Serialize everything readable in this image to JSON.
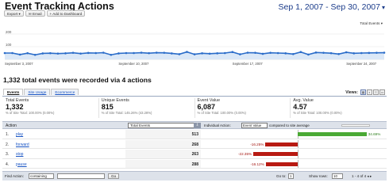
{
  "header": {
    "title": "Event Tracking Actions",
    "date_range": "Sep 1, 2007 - Sep 30, 2007"
  },
  "toolbar": {
    "export_label": "Export ▾",
    "email_label": "Email",
    "dashboard_label": "Add to Dashboard"
  },
  "chart": {
    "series_selector": "Total Events ▾",
    "y_ticks": [
      "200",
      "100"
    ],
    "x_ticks": [
      "September 3, 2007",
      "September 10, 2007",
      "September 17, 2007",
      "September 24, 2007"
    ],
    "line_color": "#2a6cc9",
    "fill_color": "#dbe8f7"
  },
  "chart_data": {
    "type": "area",
    "title": "",
    "series": [
      {
        "name": "Total Events",
        "values": [
          50,
          50,
          38,
          49,
          36,
          47,
          49,
          46,
          48,
          52,
          46,
          51,
          50,
          53,
          36,
          47,
          50,
          50,
          53,
          49,
          53,
          52,
          47,
          41,
          59,
          40,
          48,
          45,
          48,
          50,
          58,
          40,
          53,
          52,
          44,
          52,
          50,
          48,
          42,
          58,
          38,
          54,
          52,
          49,
          42,
          56,
          48,
          50,
          51,
          52,
          53
        ]
      }
    ],
    "ylim": [
      0,
      250
    ],
    "xlabel": "",
    "ylabel": "",
    "grid": true
  },
  "summary": {
    "text": "1,332 total events were recorded via 4 actions"
  },
  "tabs": [
    {
      "label": "Events"
    },
    {
      "label": "Site Usage"
    },
    {
      "label": "Ecommerce"
    }
  ],
  "views": {
    "label": "Views:",
    "buttons": [
      "▦",
      "◐",
      "≡",
      "▭"
    ]
  },
  "metrics": [
    {
      "label": "Total Events",
      "value": "1,332",
      "sub": "% of Site Total: 100.00% (0.00%)"
    },
    {
      "label": "Unique Events",
      "value": "815",
      "sub": "% of Site Total: 145.26% (43.28%)"
    },
    {
      "label": "Event Value",
      "value": "6,087",
      "sub": "% of Site Total: 100.00% (0.00%)"
    },
    {
      "label": "Avg. Value",
      "value": "4.57",
      "sub": "% of Site Total: 100.00% (0.00%)"
    }
  ],
  "table": {
    "action_header": "Action",
    "metric_select": "Total Events",
    "sort_icon": "⇩",
    "compare_label": "Individual Action:",
    "compare_select": "Event Value",
    "compare_text": "compared to site average",
    "rows": [
      {
        "num": "1.",
        "action": "play",
        "value": "513",
        "pct": "34.69%",
        "change": 34.69
      },
      {
        "num": "2.",
        "action": "forward",
        "value": "268",
        "pct": "-16.25%",
        "change": -16.25
      },
      {
        "num": "3.",
        "action": "stop",
        "value": "263",
        "pct": "-22.35%",
        "change": -22.35
      },
      {
        "num": "4.",
        "action": "pause",
        "value": "288",
        "pct": "-16.12%",
        "change": -16.12
      }
    ]
  },
  "footer": {
    "find_label": "Find Action:",
    "find_mode": "containing",
    "go_label": "Go",
    "goto_label": "Go to:",
    "goto_value": "1",
    "rows_label": "Show rows:",
    "rows_value": "10",
    "pager_text": "1 - 4 of 4 ◂ ▸"
  },
  "colors": {
    "positive": "#4aa934",
    "negative": "#b81a12",
    "link": "#1a55c4"
  }
}
